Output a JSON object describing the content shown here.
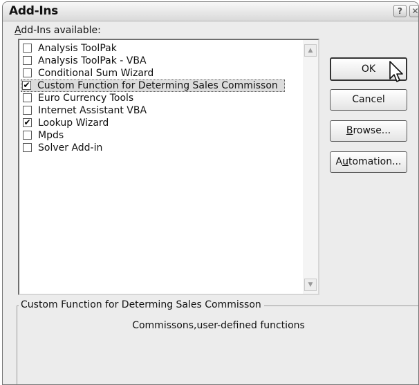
{
  "dialog": {
    "title": "Add-Ins",
    "help_label": "?",
    "close_label": "✕"
  },
  "addins": {
    "label_prefix": "A",
    "label_rest": "dd-Ins available:",
    "items": [
      {
        "label": "Analysis ToolPak",
        "checked": false
      },
      {
        "label": "Analysis ToolPak - VBA",
        "checked": false
      },
      {
        "label": "Conditional Sum Wizard",
        "checked": false
      },
      {
        "label": "Custom Function for Determing Sales Commisson",
        "checked": true,
        "selected": true
      },
      {
        "label": "Euro Currency Tools",
        "checked": false
      },
      {
        "label": "Internet Assistant VBA",
        "checked": false
      },
      {
        "label": "Lookup Wizard",
        "checked": true
      },
      {
        "label": "Mpds",
        "checked": false
      },
      {
        "label": "Solver Add-in",
        "checked": false
      }
    ],
    "scroll_up_icon": "▲",
    "scroll_down_icon": "▼"
  },
  "buttons": {
    "ok": "OK",
    "cancel": "Cancel",
    "browse_mnemonic": "B",
    "browse_rest": "rowse...",
    "automation_pre": "A",
    "automation_mnemonic": "u",
    "automation_rest": "tomation..."
  },
  "details": {
    "title": "Custom Function for Determing Sales Commisson",
    "description": "Commissons,user-defined functions"
  },
  "check_mark": "✔"
}
